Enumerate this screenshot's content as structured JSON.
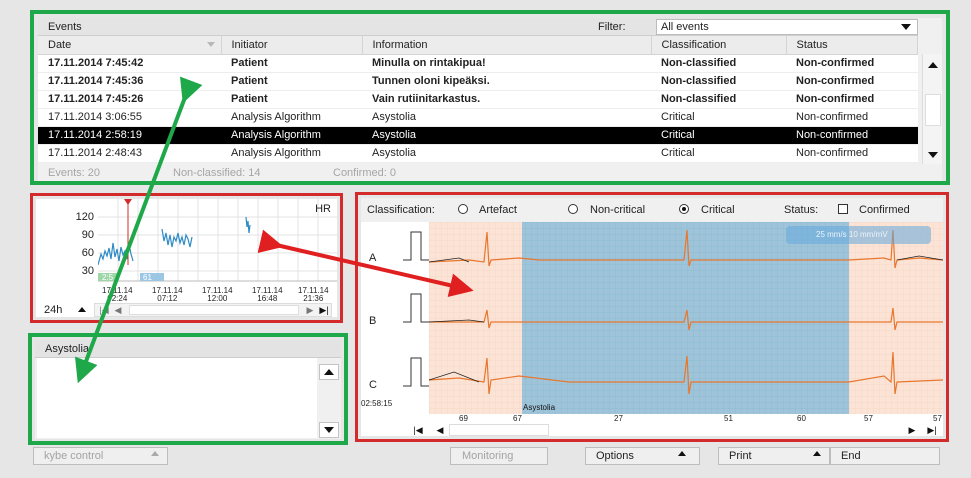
{
  "events": {
    "title": "Events",
    "filter_label": "Filter:",
    "filter_value": "All events",
    "columns": [
      "Date",
      "Initiator",
      "Information",
      "Classification",
      "Status"
    ],
    "rows": [
      {
        "date": "17.11.2014 7:45:42",
        "initiator": "Patient",
        "information": "Minulla on rintakipua!",
        "classification": "Non-classified",
        "status": "Non-confirmed"
      },
      {
        "date": "17.11.2014 7:45:36",
        "initiator": "Patient",
        "information": "Tunnen oloni kipeäksi.",
        "classification": "Non-classified",
        "status": "Non-confirmed"
      },
      {
        "date": "17.11.2014 7:45:26",
        "initiator": "Patient",
        "information": "Vain rutiinitarkastus.",
        "classification": "Non-classified",
        "status": "Non-confirmed"
      },
      {
        "date": "17.11.2014 3:06:55",
        "initiator": "Analysis Algorithm",
        "information": "Asystolia",
        "classification": "Critical",
        "status": "Non-confirmed"
      },
      {
        "date": "17.11.2014 2:58:19",
        "initiator": "Analysis Algorithm",
        "information": "Asystolia",
        "classification": "Critical",
        "status": "Non-confirmed"
      },
      {
        "date": "17.11.2014 2:48:43",
        "initiator": "Analysis Algorithm",
        "information": "Asystolia",
        "classification": "Critical",
        "status": "Non-confirmed"
      }
    ],
    "footer": {
      "events": "Events: 20",
      "nonclassified": "Non-classified: 14",
      "confirmed": "Confirmed: 0"
    }
  },
  "hr": {
    "label": "HR",
    "ticks": [
      "120",
      "90",
      "60",
      "30"
    ],
    "badge_a": "2:5",
    "badge_b": "61",
    "time_labels": [
      {
        "date": "17.11.14",
        "time": "02:24"
      },
      {
        "date": "17.11.14",
        "time": "07:12"
      },
      {
        "date": "17.11.14",
        "time": "12:00"
      },
      {
        "date": "17.11.14",
        "time": "16:48"
      },
      {
        "date": "17.11.14",
        "time": "21:36"
      }
    ],
    "range": "24h"
  },
  "details": {
    "title": "Asystolia"
  },
  "ecg": {
    "classification_label": "Classification:",
    "options": [
      "Artefact",
      "Non-critical",
      "Critical"
    ],
    "selected": "Critical",
    "status_label": "Status:",
    "confirmed_label": "Confirmed",
    "speed": "25 mm/s 10 mm/mV",
    "leads": [
      "A",
      "B",
      "C"
    ],
    "time": "02:58:15",
    "event_label": "Asystolia",
    "beat_numbers": [
      "69",
      "67",
      "27",
      "51",
      "60",
      "57",
      "57"
    ]
  },
  "buttons": {
    "kybe": "kybe control",
    "monitoring": "Monitoring",
    "options": "Options",
    "print": "Print",
    "end": "End"
  },
  "colors": {
    "green_frame": "#1fa84a",
    "red_frame": "#d32b2b",
    "selected_row": "#000000",
    "ecg_trace": "#e8772e",
    "ecg_highlight": "#8fbad6"
  }
}
